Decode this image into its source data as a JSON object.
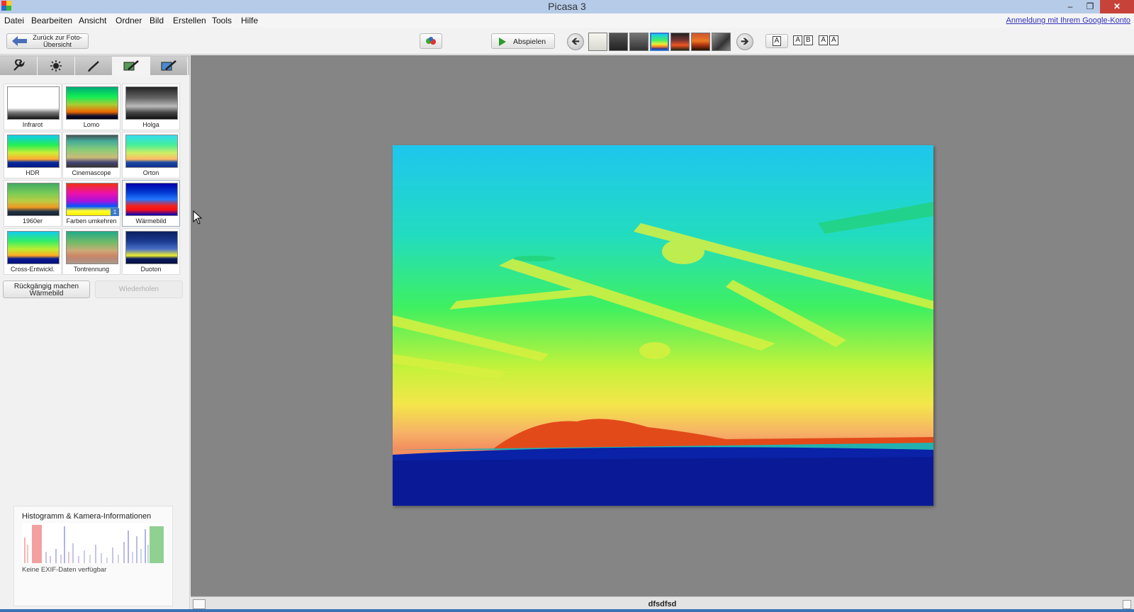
{
  "window": {
    "title": "Picasa 3",
    "minimize": "–",
    "restore": "❐",
    "close": "✕"
  },
  "menu": [
    "Datei",
    "Bearbeiten",
    "Ansicht",
    "Ordner",
    "Bild",
    "Erstellen",
    "Tools",
    "Hilfe"
  ],
  "signin_link": "Anmeldung mit Ihrem Google-Konto",
  "toolbar": {
    "back_line1": "Zurück zur Foto-",
    "back_line2": "Übersicht",
    "play_label": "Abspielen",
    "compare_1": "A",
    "compare_2a": "A",
    "compare_2b": "B",
    "compare_3a": "A",
    "compare_3b": "A",
    "prev_glyph": "🡸",
    "next_glyph": "🡺"
  },
  "tabs": [
    {
      "icon": "wrench-icon"
    },
    {
      "icon": "light-icon"
    },
    {
      "icon": "brush-icon"
    },
    {
      "icon": "effects-brush-icon",
      "active": true
    },
    {
      "icon": "effects2-brush-icon"
    }
  ],
  "effects": [
    {
      "label": "Infrarot",
      "gradient": "linear-gradient(#fff 0%,#fff 65%,#777 80%,#111 100%)"
    },
    {
      "label": "Lomo",
      "gradient": "linear-gradient(#0a7 0%,#1e5 30%,#ac3 55%,#e60 78%,#113 90%,#001 100%)"
    },
    {
      "label": "Holga",
      "gradient": "linear-gradient(#222 0%,#666 35%,#bbb 60%,#444 80%,#111 100%)"
    },
    {
      "label": "HDR",
      "gradient": "linear-gradient(#1ce 0%,#2e5 30%,#ce3 55%,#fa3 75%,#0a2a9a 85%,#001a8a 100%)"
    },
    {
      "label": "Cinemascope",
      "gradient": "linear-gradient(#455 0%,#4a9 18%,#8c7 45%,#cb7 70%,#447 85%,#333 100%)"
    },
    {
      "label": "Orton",
      "gradient": "linear-gradient(#3de 0%,#4e9 30%,#ce6 55%,#fb6 75%,#1a4aa0 85%,#103090 100%)"
    },
    {
      "label": "1960er",
      "gradient": "linear-gradient(#4a6 0%,#7c5 30%,#bc4 55%,#e92 75%,#234 88%,#123 100%)"
    },
    {
      "label": "Farben umkehren",
      "gradient": "linear-gradient(#e31 0%,#e1a 30%,#a1d 55%,#05f 72%,#ff3 86%,#fe0 100%)",
      "badge": "1"
    },
    {
      "label": "Wärmebild",
      "gradient": "linear-gradient(#00a 0%,#03c 25%,#27f 50%,#e22 70%,#f11 82%,#00b 100%)"
    },
    {
      "label": "Cross-Entwickl.",
      "gradient": "linear-gradient(#1ce 0%,#3e6 30%,#be3 55%,#fa2 75%,#0a1a90 85%,#001080 100%)"
    },
    {
      "label": "Tontrennung",
      "gradient": "linear-gradient(#2a8 0%,#7b6 35%,#ca7 60%,#c86 75%,#b87 85%,#a98 100%)"
    },
    {
      "label": "Duoton",
      "gradient": "linear-gradient(#0b2060 0%,#1a3a90 30%,#4a70c8 55%,#ee3 75%,#0a1a60 85%,#061040 100%)"
    }
  ],
  "undo_line1": "Rückgängig machen",
  "undo_line2": "Wärmebild",
  "redo_label": "Wiederholen",
  "histogram": {
    "title": "Histogramm & Kamera-Informationen",
    "exif": "Keine EXIF-Daten verfügbar"
  },
  "status": {
    "caption": "dfsdfsd"
  }
}
